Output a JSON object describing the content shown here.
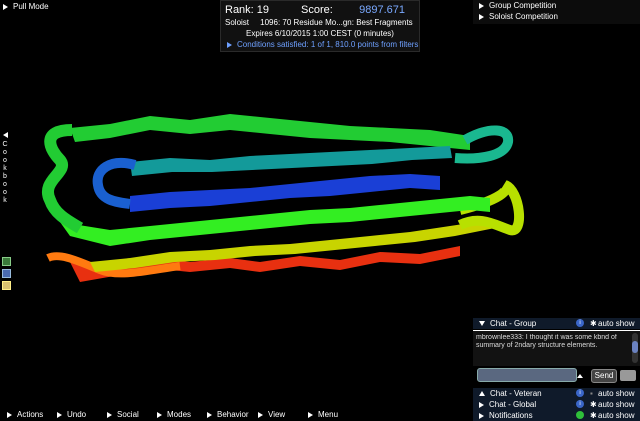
{
  "pull_mode": {
    "label": "Pull Mode"
  },
  "cookbook": {
    "label": "Cookbook",
    "letters": [
      "C",
      "o",
      "o",
      "k",
      "b",
      "o",
      "o",
      "k"
    ]
  },
  "score_panel": {
    "rank_label": "Rank: 19",
    "score_label": "Score:",
    "score_value": "9897.671",
    "mode": "Soloist",
    "puzzle": "1096: 70 Residue Mo...gn: Best Fragments",
    "expires": "Expires 6/10/2015 1:00 CEST (0 minutes)",
    "conditions": "Conditions satisfied: 1 of 1, 810.0 points from filters"
  },
  "competitions": [
    {
      "label": "Group Competition"
    },
    {
      "label": "Soloist Competition"
    }
  ],
  "chat": {
    "group_label": "Chat - Group",
    "message": "mbrownlee333: I thought it was some kbnd of summary of 2ndary structure elements.",
    "send_label": "Send",
    "input_value": "",
    "veteran_label": "Chat - Veteran",
    "global_label": "Chat - Global",
    "notifications_label": "Notifications",
    "auto_show": "auto show"
  },
  "menu": {
    "actions": "Actions",
    "undo": "Undo",
    "social": "Social",
    "modes": "Modes",
    "behavior": "Behavior",
    "view": "View",
    "menu": "Menu"
  },
  "colors": {
    "strand_green": "#22cc33",
    "strand_blue": "#1a3fd6",
    "strand_teal": "#139a9a",
    "strand_yellow": "#c8d400",
    "strand_red": "#e83010",
    "score_blue": "#7aa9ff"
  }
}
